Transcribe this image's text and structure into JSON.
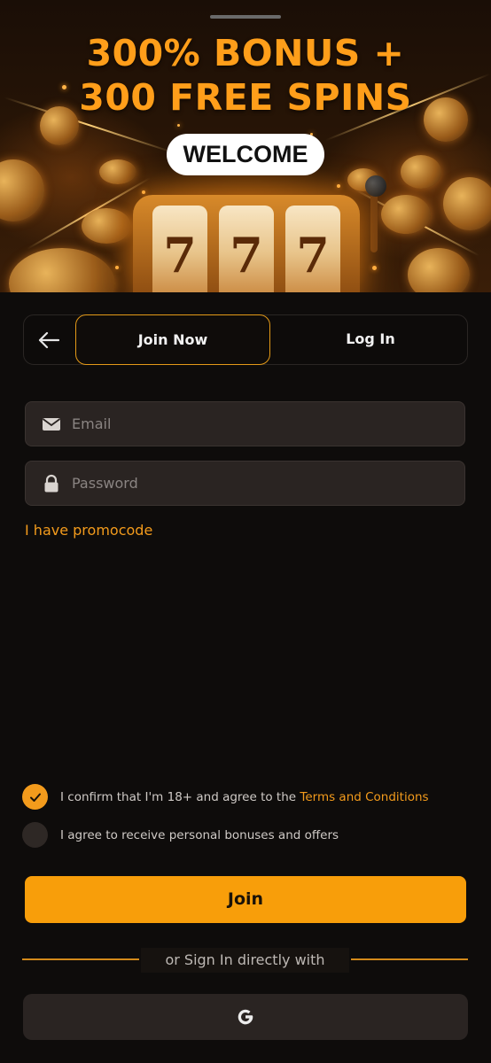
{
  "hero": {
    "title_line1": "300% BONUS +",
    "title_line2": "300 FREE SPINS",
    "badge": "WELCOME",
    "reel_symbols": [
      "7",
      "7",
      "7"
    ]
  },
  "tabs": {
    "back_icon": "arrow-left-icon",
    "join_label": "Join Now",
    "login_label": "Log In",
    "active": "join"
  },
  "form": {
    "email": {
      "icon": "envelope-icon",
      "placeholder": "Email",
      "value": ""
    },
    "password": {
      "icon": "lock-icon",
      "placeholder": "Password",
      "value": ""
    },
    "promo_link": "I have promocode"
  },
  "consents": {
    "age": {
      "text": "I confirm that I'm 18+ and agree to the ",
      "link": "Terms and Conditions",
      "checked": true
    },
    "bonuses": {
      "text": "I agree to receive personal bonuses and offers",
      "checked": false
    }
  },
  "join_button": "Join",
  "social": {
    "divider_text": "or Sign In directly with",
    "google_icon": "google-icon"
  },
  "colors": {
    "accent": "#f89e0a",
    "background": "#0e0c0b",
    "field_bg": "#2a2422",
    "link": "#f39b1c"
  }
}
